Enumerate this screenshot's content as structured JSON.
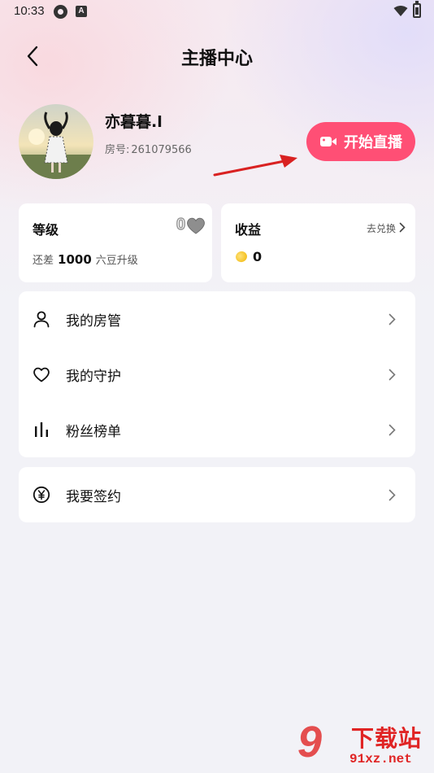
{
  "status_bar": {
    "time": "10:33",
    "notif_icon_1": "sync-icon",
    "notif_icon_2": "a-letter-icon",
    "wifi_icon": "wifi-icon",
    "battery_icon": "battery-icon"
  },
  "header": {
    "title": "主播中心",
    "back_icon": "back-arrow-icon"
  },
  "profile": {
    "username": "亦暮暮.l",
    "room_label": "房号:",
    "room_number": "261079566",
    "live_button": "开始直播",
    "live_icon": "video-camera-icon"
  },
  "level_card": {
    "title": "等级",
    "level_value": "0",
    "level_icon": "heart-badge-icon",
    "desc_prefix": "还差",
    "desc_amount": "1000",
    "desc_suffix": "六豆升级"
  },
  "income_card": {
    "title": "收益",
    "exchange_link": "去兑换",
    "coin_icon": "coin-icon",
    "value": "0"
  },
  "menu": {
    "items": [
      {
        "label": "我的房管",
        "icon": "person-icon"
      },
      {
        "label": "我的守护",
        "icon": "heart-outline-icon"
      },
      {
        "label": "粉丝榜单",
        "icon": "bar-chart-icon"
      }
    ]
  },
  "sign_item": {
    "label": "我要签约",
    "icon": "yen-circle-icon"
  },
  "watermark": {
    "logo": "9",
    "title": "下载站",
    "url": "91xz.net"
  },
  "colors": {
    "accent": "#ff4f75",
    "annotation_arrow": "#d92121",
    "watermark": "#e02424"
  }
}
